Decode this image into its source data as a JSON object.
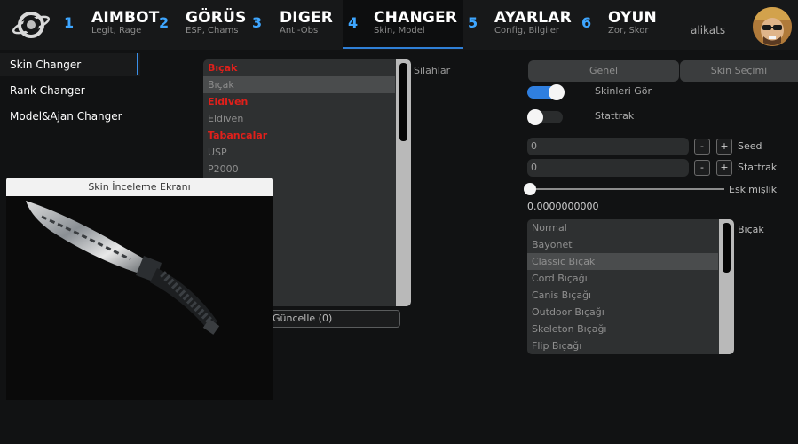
{
  "nav_tabs": [
    {
      "num": "1",
      "title": "AIMBOT",
      "subtitle": "Legit, Rage"
    },
    {
      "num": "2",
      "title": "GÖRÜS",
      "subtitle": "ESP, Chams"
    },
    {
      "num": "3",
      "title": "DIGER",
      "subtitle": "Anti-Obs"
    },
    {
      "num": "4",
      "title": "CHANGER",
      "subtitle": "Skin, Model"
    },
    {
      "num": "5",
      "title": "AYARLAR",
      "subtitle": "Config, Bilgiler"
    },
    {
      "num": "6",
      "title": "OYUN",
      "subtitle": "Zor, Skor"
    }
  ],
  "active_tab": "CHANGER",
  "user": {
    "name": "alikats"
  },
  "sidebar": {
    "items": [
      {
        "label": "Skin Changer",
        "active": true
      },
      {
        "label": "Rank Changer",
        "active": false
      },
      {
        "label": "Model&Ajan Changer",
        "active": false
      }
    ]
  },
  "preview": {
    "title": "Skin İnceleme Ekranı"
  },
  "weapons": {
    "label": "Silahlar",
    "rows": [
      {
        "text": "Bıçak",
        "kind": "header"
      },
      {
        "text": "Bıçak",
        "kind": "selected"
      },
      {
        "text": "Eldiven",
        "kind": "header"
      },
      {
        "text": "Eldiven",
        "kind": "item"
      },
      {
        "text": "Tabancalar",
        "kind": "header"
      },
      {
        "text": "USP",
        "kind": "item"
      },
      {
        "text": "P2000",
        "kind": "item"
      }
    ],
    "update_button": "Güncelle (0)"
  },
  "settings": {
    "seg_general": "Genel",
    "seg_skin": "Skin Seçimi",
    "toggle_show_skins": {
      "label": "Skinleri Gör",
      "on": true
    },
    "toggle_stattrak": {
      "label": "Stattrak",
      "on": false
    },
    "seed": {
      "label": "Seed",
      "value": "0",
      "minus": "-",
      "plus": "+"
    },
    "stattrak_field": {
      "label": "Stattrak",
      "value": "0",
      "minus": "-",
      "plus": "+"
    },
    "wear": {
      "label": "Eskimişlik",
      "value": "0.0000000000"
    }
  },
  "knives": {
    "label": "Bıçak",
    "rows": [
      {
        "text": "Normal",
        "selected": false
      },
      {
        "text": "Bayonet",
        "selected": false
      },
      {
        "text": "Classic Bıçak",
        "selected": true
      },
      {
        "text": "Cord Bıçağı",
        "selected": false
      },
      {
        "text": "Canis Bıçağı",
        "selected": false
      },
      {
        "text": "Outdoor Bıçağı",
        "selected": false
      },
      {
        "text": "Skeleton Bıçağı",
        "selected": false
      },
      {
        "text": "Flip Bıçağı",
        "selected": false
      }
    ]
  },
  "colors": {
    "accent": "#3ea6ff",
    "header_red": "#e0201b",
    "toggle_on": "#2f7fe0"
  }
}
